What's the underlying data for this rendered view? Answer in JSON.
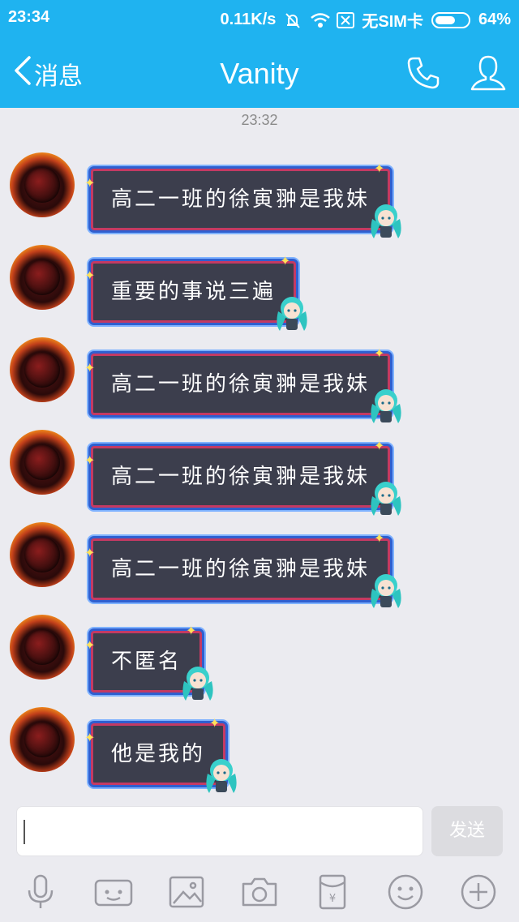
{
  "status": {
    "time": "23:34",
    "net_speed": "0.11K/s",
    "sim": "无SIM卡",
    "battery": "64%",
    "battery_level": 0.64
  },
  "header": {
    "back_label": "消息",
    "title": "Vanity"
  },
  "timestamp": "23:32",
  "messages": [
    {
      "text": "高二一班的徐寅翀是我妹"
    },
    {
      "text": "重要的事说三遍"
    },
    {
      "text": "高二一班的徐寅翀是我妹"
    },
    {
      "text": "高二一班的徐寅翀是我妹"
    },
    {
      "text": "高二一班的徐寅翀是我妹"
    },
    {
      "text": "不匿名"
    },
    {
      "text": "他是我的"
    }
  ],
  "input": {
    "value": "",
    "send_label": "发送"
  },
  "toolbar": {
    "icons": [
      "microphone-icon",
      "video-call-icon",
      "image-icon",
      "camera-icon",
      "red-packet-icon",
      "emoji-icon",
      "plus-icon"
    ]
  },
  "colors": {
    "accent": "#1fb3f0",
    "background": "#ebebf0",
    "bubble_fill": "#3c3e4d",
    "bubble_border": "#c43a63",
    "bubble_glow": "#2f5fcf"
  }
}
